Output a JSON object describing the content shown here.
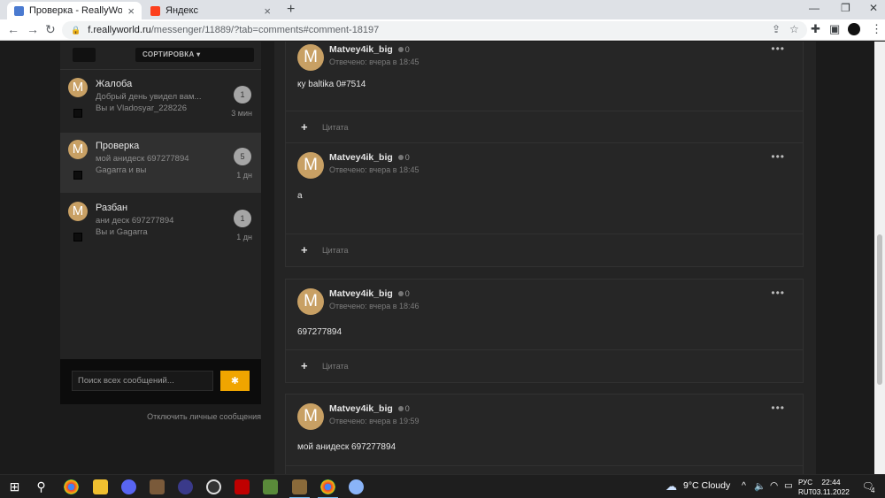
{
  "browser": {
    "tabs": [
      {
        "title": "Проверка - ReallyWorld",
        "active": true,
        "favicon_color": "#4a7ad0"
      },
      {
        "title": "Яндекс",
        "active": false,
        "favicon_color": "#fc3f1d"
      }
    ],
    "new_tab_icon": "plus-icon",
    "address": {
      "host": "f.reallyworld.ru",
      "path": "/messenger/11889/?tab=comments#comment-18197"
    },
    "window_controls": [
      "minimize-icon",
      "maximize-icon",
      "close-icon"
    ]
  },
  "sidebar": {
    "sort_label": "СОРТИРОВКА ▾",
    "conversations": [
      {
        "avatar": "M",
        "title": "Жалоба",
        "preview": "Добрый день увидел вам...",
        "members": "Вы и Vladosyar_228226",
        "count": "1",
        "time": "3 мин",
        "selected": false
      },
      {
        "avatar": "M",
        "title": "Проверка",
        "preview": "мой анидеск 697277894",
        "members": "Gagarra и вы",
        "count": "5",
        "time": "1 дн",
        "selected": true
      },
      {
        "avatar": "M",
        "title": "Разбан",
        "preview": "ани деск 697277894",
        "members": "Вы и Gagarra",
        "count": "1",
        "time": "1 дн",
        "selected": false
      }
    ],
    "search_placeholder": "Поиск всех сообщений...",
    "search_button_icon": "gear-icon",
    "disable_link": "Отключить личные сообщения"
  },
  "posts": [
    {
      "avatar": "M",
      "author": "Matvey4ik_big",
      "karma": "0",
      "date": "Отвечено: вчера в 18:45",
      "body": "ку baltika 0#7514",
      "quote_label": "Цитата",
      "menu": "•••"
    },
    {
      "avatar": "M",
      "author": "Matvey4ik_big",
      "karma": "0",
      "date": "Отвечено: вчера в 18:45",
      "body": "а",
      "quote_label": "Цитата",
      "menu": "•••"
    },
    {
      "avatar": "M",
      "author": "Matvey4ik_big",
      "karma": "0",
      "date": "Отвечено: вчера в 18:46",
      "body": "697277894",
      "quote_label": "Цитата",
      "menu": "•••"
    },
    {
      "avatar": "M",
      "author": "Matvey4ik_big",
      "karma": "0",
      "date": "Отвечено: вчера в 19:59",
      "body": "мой анидеск 697277894",
      "quote_label": "Цитата",
      "menu": "•••"
    }
  ],
  "taskbar": {
    "weather": "9°C  Cloudy",
    "lang": "РУС",
    "lang2": "RUT",
    "time": "22:44",
    "date": "03.11.2022",
    "notifications": "4",
    "apps": [
      "windows-start-icon",
      "search-icon",
      "chrome-icon",
      "file-explorer-icon",
      "discord-icon",
      "minecraft-launcher-icon",
      "app-icon",
      "obs-icon",
      "filezilla-icon",
      "minecraft-icon",
      "winrar-icon",
      "chrome-active-icon",
      "app-icon-2"
    ]
  }
}
